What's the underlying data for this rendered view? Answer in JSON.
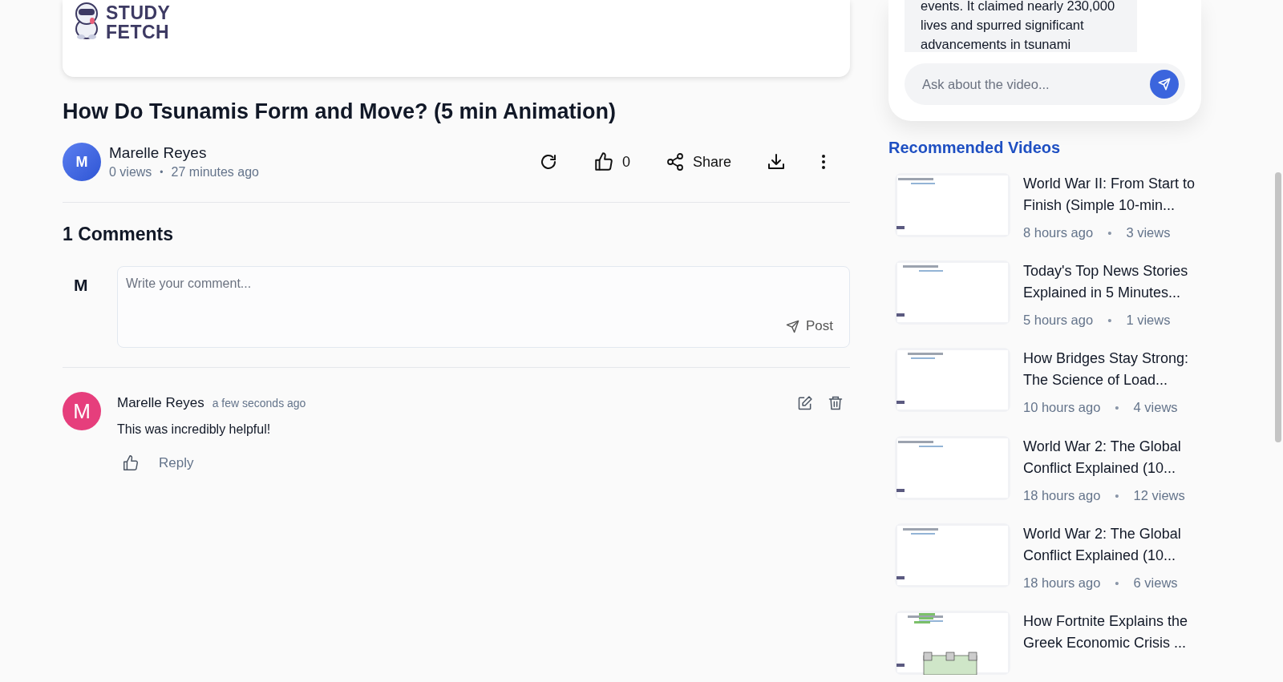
{
  "player": {
    "logo_text": [
      "STUDY",
      "FETCH"
    ]
  },
  "video": {
    "title": "How Do Tsunamis Form and Move? (5 min Animation)",
    "author": {
      "initial": "M",
      "name": "Marelle Reyes",
      "views": "0 views",
      "separator": "•",
      "time": "27 minutes ago"
    },
    "actions": [
      {
        "kind": "refresh"
      },
      {
        "kind": "like",
        "label": "0"
      },
      {
        "kind": "share",
        "label": "Share"
      },
      {
        "kind": "download"
      },
      {
        "kind": "more"
      }
    ]
  },
  "comments": {
    "heading": "1 Comments",
    "composer": {
      "initial": "M",
      "placeholder": "Write your comment...",
      "post": "Post"
    },
    "items": [
      {
        "initial": "M",
        "name": "Marelle Reyes",
        "time": "a few seconds ago",
        "text": "This was incredibly helpful!",
        "reply": "Reply"
      }
    ]
  },
  "chat": {
    "message_lines": [
      "events. It claimed nearly 230,000",
      "lives and spurred significant",
      "advancements in tsunami"
    ],
    "placeholder": "Ask about the video..."
  },
  "recommended": {
    "heading": "Recommended Videos",
    "items": [
      {
        "title": "World War II: From Start to Finish (Simple 10-min...",
        "time": "8 hours ago",
        "separator": "•",
        "views": "3 views"
      },
      {
        "title": "Today's Top News Stories Explained in 5 Minutes...",
        "time": "5 hours ago",
        "separator": "•",
        "views": "1 views"
      },
      {
        "title": "How Bridges Stay Strong: The Science of Load...",
        "time": "10 hours ago",
        "separator": "•",
        "views": "4 views"
      },
      {
        "title": "World War 2: The Global Conflict Explained (10...",
        "time": "18 hours ago",
        "separator": "•",
        "views": "12 views"
      },
      {
        "title": "World War 2: The Global Conflict Explained (10...",
        "time": "18 hours ago",
        "separator": "•",
        "views": "6 views"
      },
      {
        "title": "How Fortnite Explains the Greek Economic Crisis ..."
      }
    ]
  }
}
